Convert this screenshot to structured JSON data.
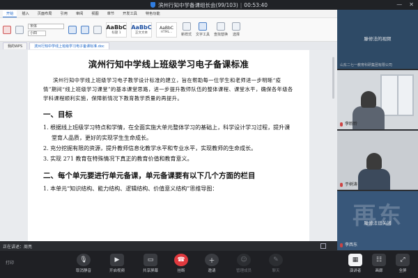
{
  "titlebar": {
    "meeting": "滨州行知中学备课组长会(99/103)",
    "separator": "|",
    "timer": "00:53:40"
  },
  "ribbon": {
    "menu_tabs": [
      "开始",
      "插入",
      "页面布局",
      "引用",
      "审阅",
      "视图",
      "章节",
      "开发工具",
      "特色功能"
    ],
    "font_name": "宋体",
    "font_size": "小四",
    "styles": [
      {
        "sample": "AaBbC",
        "label": "标题 1"
      },
      {
        "sample": "AaBbC",
        "label": "正文文本"
      },
      {
        "sample": "AaBbC",
        "label": "HTML..."
      }
    ],
    "tools": [
      "新样式",
      "文字工具",
      "查找替换",
      "选择"
    ]
  },
  "doc_tabs": [
    "我的WPS",
    "滨州行知中学线上班级学习电子备课标准.doc"
  ],
  "document": {
    "title": "滨州行知中学线上班级学习电子备课标准",
    "intro": "滨州行知中学线上班级学习电子教学设计标准的建立，旨在帮助每一位学生和老师进一步明晰“疫情”期间“线上班级学习课堂”的基本课堂思路，进一步提升教师队伍的整体课程、课堂水平，确保各年级各学科课程顺利实施，保障新情况下教育教学质量的再提升。",
    "section1": "一、目标",
    "goals": [
      "1. 根据线上班级学习特点和学情，在全面实施大单元整体学习的基础上，科学设计学习过程，提升课",
      "堂育人品质，更好的实现学生生命成长。",
      "2. 充分挖掘有限的资源，提升教师信息化教学水平和专业水平，实现教师的生命成长。",
      "3. 实现 271 教育在特殊情况下真正的教育价值和教育意义。"
    ],
    "section2": "二、每个单元要进行单元备课，单元备课要有以下几个方面的栏目",
    "unit_item": "1. 本单元“知识结构、能力结构、逻辑结构、价值意义结构”思维导图："
  },
  "share_status": "正在讲述：周亮",
  "participants": [
    {
      "name": "滕修法的视频",
      "caption": "山东二七一教育科研集团有限公司",
      "watermark": ""
    },
    {
      "name": "李聆聆",
      "caption": "",
      "watermark": ""
    },
    {
      "name": "于树涛",
      "caption": "",
      "watermark": ""
    },
    {
      "name": "李西东",
      "caption": "滕修法已关闭",
      "watermark": "再东"
    }
  ],
  "toolbar": {
    "left_label": "打印",
    "buttons": [
      {
        "label": "取消静音",
        "icon": "mic-icon"
      },
      {
        "label": "开启视频",
        "icon": "camera-icon"
      },
      {
        "label": "共享屏幕",
        "icon": "share-screen-icon"
      },
      {
        "label": "挂断",
        "icon": "hangup-icon"
      },
      {
        "label": "邀请",
        "icon": "invite-icon"
      },
      {
        "label": "管理成员",
        "icon": "members-icon"
      },
      {
        "label": "聊天",
        "icon": "chat-icon"
      }
    ],
    "right_buttons": [
      {
        "label": "演讲者",
        "icon": "speaker-view-icon"
      },
      {
        "label": "画廊",
        "icon": "gallery-view-icon"
      },
      {
        "label": "全屏",
        "icon": "fullscreen-icon"
      }
    ]
  },
  "colors": {
    "accent": "#1a64c8",
    "hangup": "#e0393e",
    "panel": "#2b2d31"
  }
}
